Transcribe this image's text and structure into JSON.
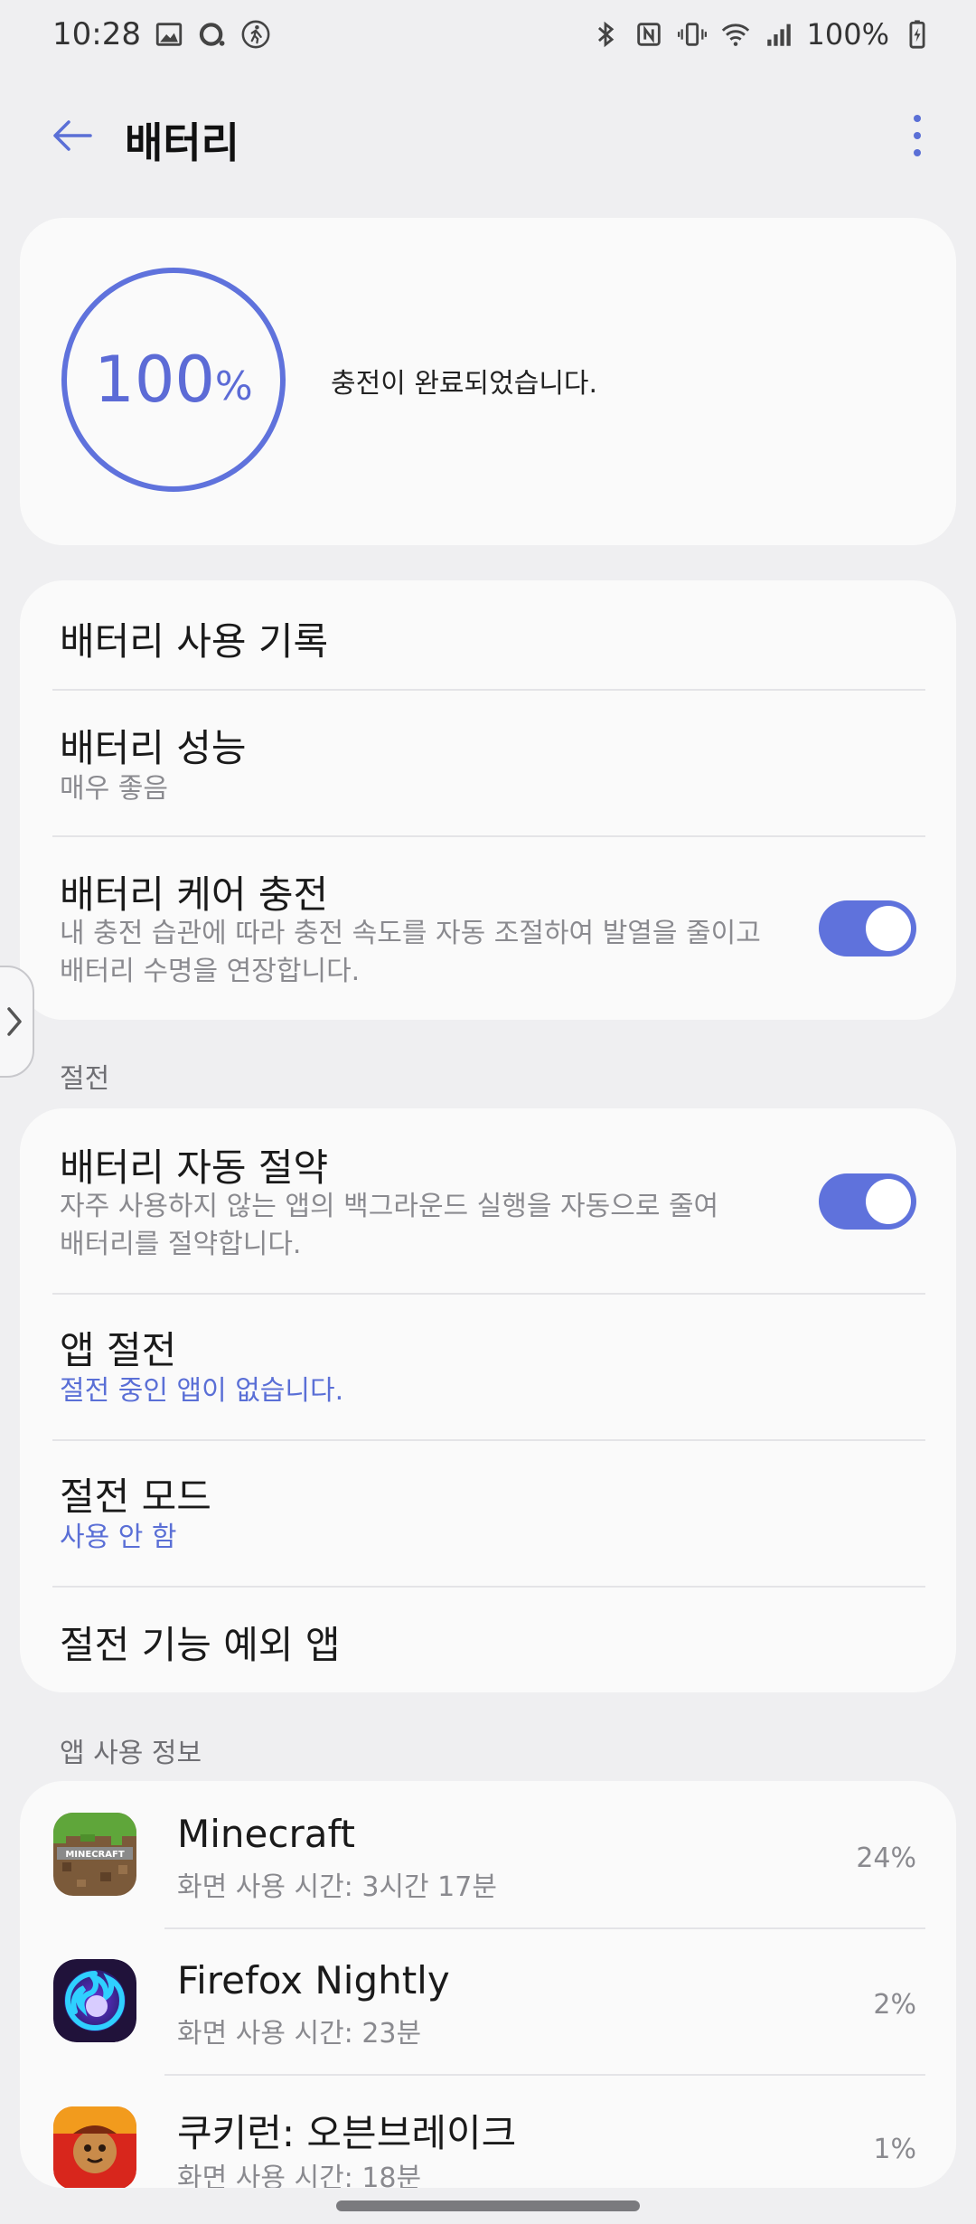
{
  "status_bar": {
    "time": "10:28",
    "battery_pct": "100%",
    "left_icons": [
      "gallery-icon",
      "circle-icon",
      "accessibility-icon"
    ],
    "right_icons": [
      "bluetooth-icon",
      "nfc-icon",
      "vibrate-icon",
      "wifi-icon",
      "signal-icon",
      "battery-charging-icon"
    ]
  },
  "header": {
    "title": "배터리"
  },
  "battery": {
    "level": 100,
    "level_number": "100",
    "level_unit": "%",
    "status": "충전이 완료되었습니다."
  },
  "main_list": {
    "usage_history": "배터리 사용 기록",
    "performance_title": "배터리 성능",
    "performance_value": "매우 좋음",
    "care_title": "배터리 케어 충전",
    "care_desc_1": "내 충전 습관에 따라 충전 속도를 자동 조절하여 발열을 줄이고",
    "care_desc_2": "배터리 수명을 연장합니다.",
    "care_enabled": true
  },
  "saving_section": {
    "label": "절전",
    "auto_title": "배터리 자동 절약",
    "auto_desc_1": "자주 사용하지 않는 앱의 백그라운드 실행을 자동으로 줄여",
    "auto_desc_2": "배터리를 절약합니다.",
    "auto_enabled": true,
    "app_saving_title": "앱 절전",
    "app_saving_value": "절전 중인 앱이 없습니다.",
    "mode_title": "절전 모드",
    "mode_value": "사용 안 함",
    "exceptions_title": "절전 기능 예외 앱"
  },
  "app_usage": {
    "label": "앱 사용 정보",
    "apps": [
      {
        "name": "Minecraft",
        "detail": "화면 사용 시간: 3시간 17분",
        "percent": "24%",
        "icon": "minecraft-icon"
      },
      {
        "name": "Firefox Nightly",
        "detail": "화면 사용 시간: 23분",
        "percent": "2%",
        "icon": "firefox-nightly-icon"
      },
      {
        "name": "쿠키런: 오븐브레이크",
        "detail": "화면 사용 시간: 18분",
        "percent": "1%",
        "icon": "cookie-run-icon"
      }
    ]
  },
  "colors": {
    "accent": "#5f72dc",
    "background": "#efeff1",
    "card": "#fafafa"
  }
}
